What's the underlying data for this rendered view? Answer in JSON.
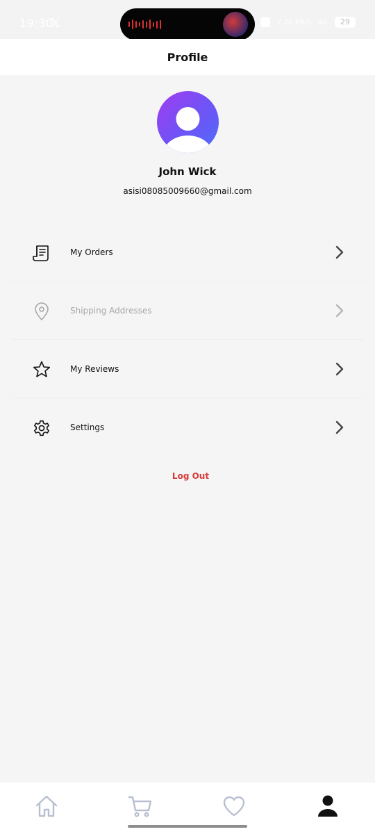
{
  "status_bar": {
    "time": "19:30",
    "battery": "29",
    "net_speed": "2.20 KB/S",
    "network_label": "4G"
  },
  "header": {
    "title": "Profile"
  },
  "profile": {
    "name": "John Wick",
    "email": "asisi08085009660@gmail.com"
  },
  "menu": {
    "items": [
      {
        "label": "My Orders",
        "icon": "receipt-icon",
        "disabled": false
      },
      {
        "label": "Shipping Addresses",
        "icon": "location-pin-icon",
        "disabled": true
      },
      {
        "label": "My Reviews",
        "icon": "star-icon",
        "disabled": false
      },
      {
        "label": "Settings",
        "icon": "gear-icon",
        "disabled": false
      }
    ]
  },
  "logout_label": "Log Out",
  "bottom_nav": {
    "items": [
      {
        "icon": "home-icon",
        "active": false
      },
      {
        "icon": "cart-icon",
        "active": false
      },
      {
        "icon": "heart-icon",
        "active": false
      },
      {
        "icon": "person-icon",
        "active": true
      }
    ]
  },
  "colors": {
    "background": "#f5f5f5",
    "logout": "#d73a3a",
    "avatar_gradient_start": "#a13cf0",
    "avatar_gradient_end": "#4f6dfa",
    "inactive_nav": "#b8bfd0",
    "active_nav": "#111111"
  }
}
